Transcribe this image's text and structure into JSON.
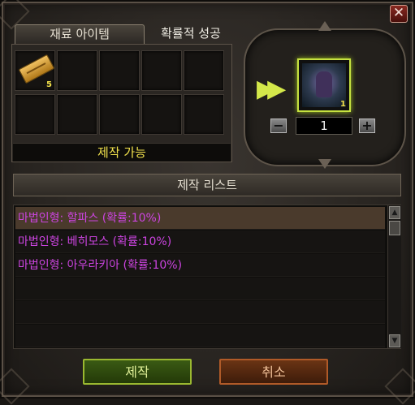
{
  "window": {
    "close_glyph": "✕"
  },
  "tabs": [
    {
      "label": "재료 아이템",
      "active": true
    },
    {
      "label": "확률적 성공",
      "active": false
    }
  ],
  "materials": {
    "slots": [
      {
        "item": "ticket-icon",
        "count": "5"
      },
      {},
      {},
      {},
      {},
      {},
      {},
      {},
      {},
      {}
    ],
    "status": "제작 가능"
  },
  "product": {
    "icon": "magic-doll-icon",
    "count": "1",
    "quantity": "1",
    "minus_label": "−",
    "plus_label": "+",
    "arrow_glyph": "▶▶"
  },
  "list": {
    "header": "제작 리스트",
    "items": [
      {
        "label": "마법인형: 할파스 (확률:10%)",
        "selected": true
      },
      {
        "label": "마법인형: 베히모스 (확률:10%)",
        "selected": false
      },
      {
        "label": "마법인형: 아우라키아 (확률:10%)",
        "selected": false
      },
      {
        "label": "",
        "selected": false
      },
      {
        "label": "",
        "selected": false
      },
      {
        "label": "",
        "selected": false
      }
    ],
    "scroll_up": "▲",
    "scroll_down": "▼"
  },
  "buttons": {
    "craft_label": "제작",
    "cancel_label": "취소"
  },
  "colors": {
    "item_text": "#cc44e0",
    "status_text": "#f2e24c",
    "highlight": "#c6e240"
  }
}
